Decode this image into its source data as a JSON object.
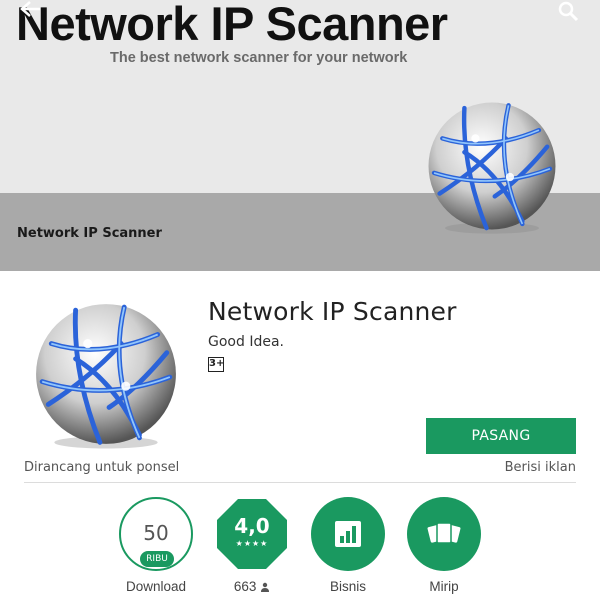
{
  "banner": {
    "title": "Network IP Scanner",
    "subtitle": "The best network scanner for your network",
    "caption": "Network IP Scanner"
  },
  "app": {
    "name": "Network IP Scanner",
    "developer": "Good Idea.",
    "content_rating": "3+",
    "install_label": "PASANG",
    "designed_for": "Dirancang untuk ponsel",
    "contains_ads": "Berisi iklan"
  },
  "stats": {
    "downloads": {
      "value": "50",
      "unit": "RIBU",
      "label": "Download"
    },
    "rating": {
      "value": "4,0",
      "stars": "★★★★",
      "count_label": "663"
    },
    "category": {
      "label": "Bisnis"
    },
    "similar": {
      "label": "Mirip"
    }
  },
  "colors": {
    "accent_green": "#1a9960",
    "banner_bg": "#e9e9e9",
    "banner_stripe": "#a9a9a9"
  },
  "icons": [
    "back-arrow-icon",
    "search-icon",
    "globe-icon",
    "person-icon",
    "bar-chart-icon",
    "cards-icon"
  ]
}
